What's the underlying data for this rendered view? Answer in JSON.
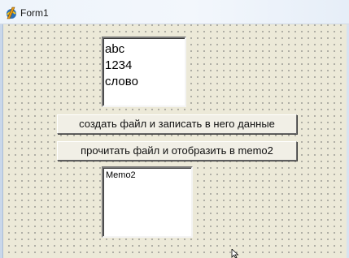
{
  "window": {
    "title": "Form1",
    "icon": "delphi-form-icon"
  },
  "memo1": {
    "lines": [
      "abc",
      "1234",
      "слово"
    ]
  },
  "buttons": {
    "create_write": "создать файл и записать в него данные",
    "read_show": "прочитать файл и отобразить в memo2"
  },
  "memo2": {
    "text": "Memo2"
  },
  "colors": {
    "form_bg": "#ece9d8",
    "memo_bg": "#ffffff",
    "titlebar_bg": "#eef4fb"
  }
}
